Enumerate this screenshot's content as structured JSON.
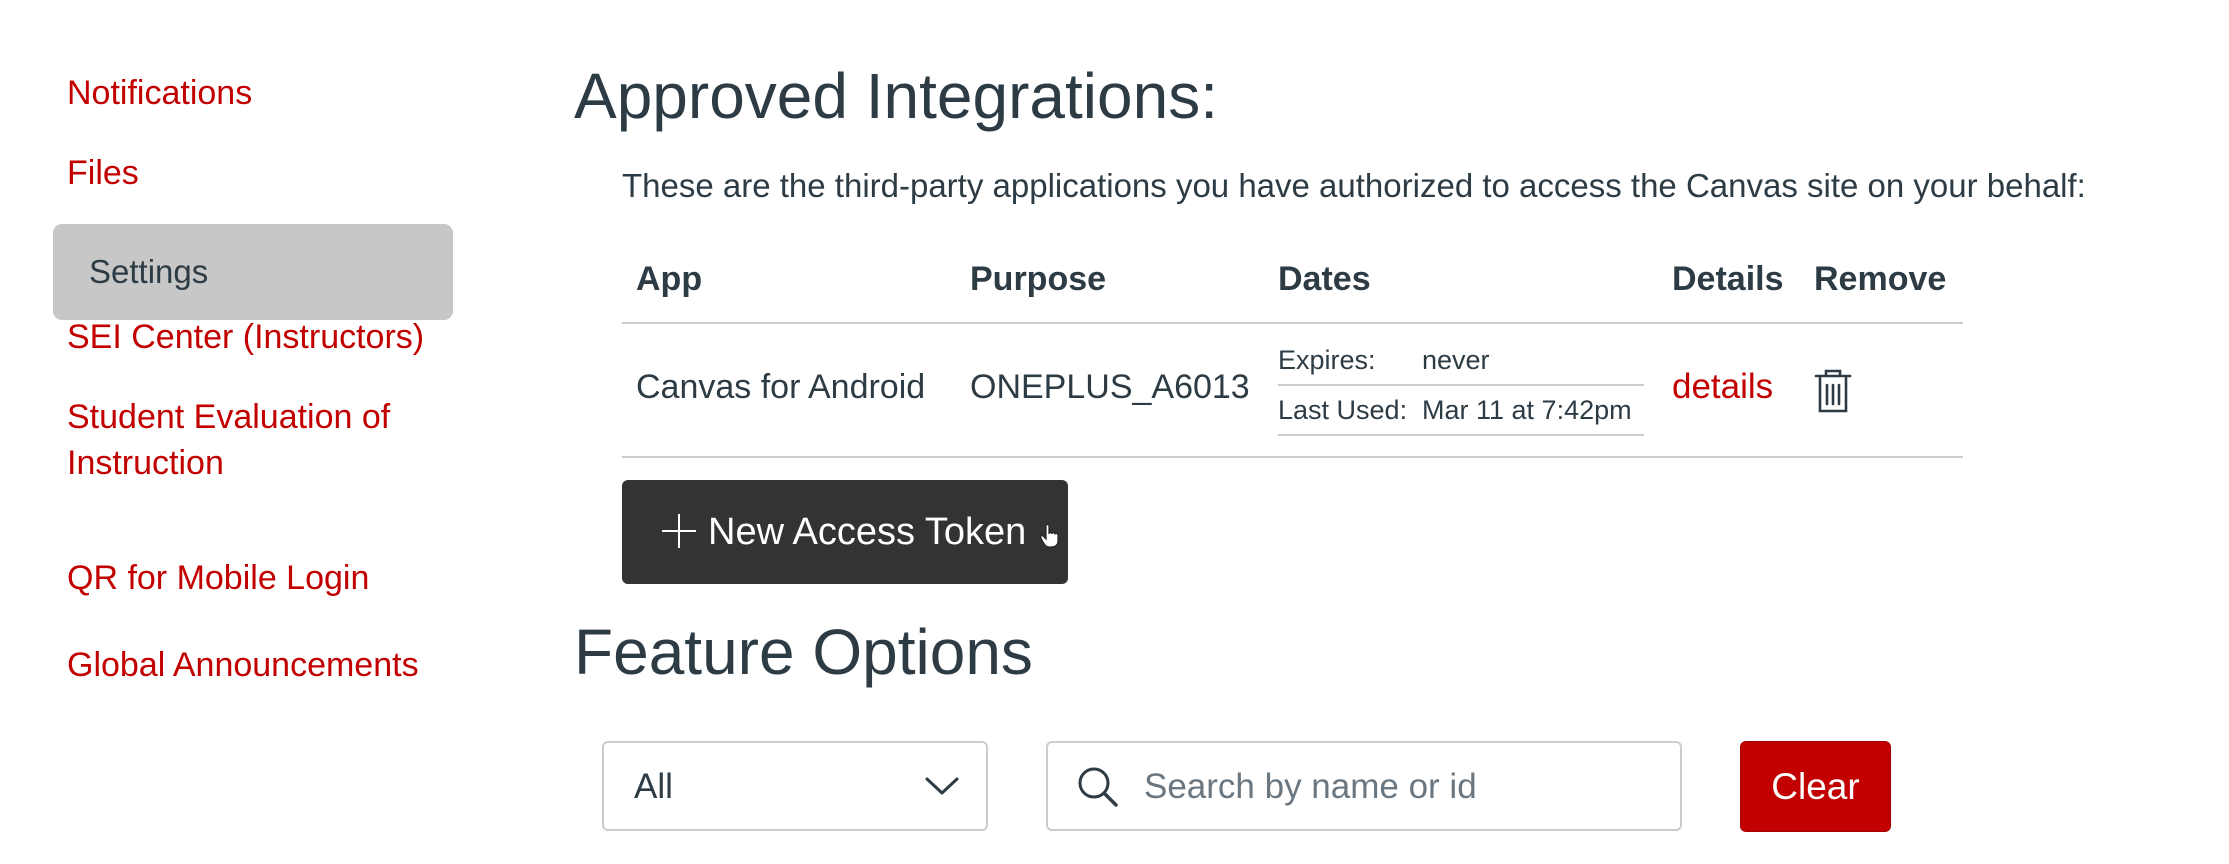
{
  "sidebar": {
    "items": [
      {
        "label": "Notifications"
      },
      {
        "label": "Files"
      },
      {
        "label": "Settings",
        "active": true
      },
      {
        "label": "SEI Center (Instructors)"
      },
      {
        "label": "Student Evaluation of"
      },
      {
        "label": "Instruction"
      },
      {
        "label": "QR for Mobile Login"
      },
      {
        "label": "Global Announcements"
      }
    ]
  },
  "integrations": {
    "heading": "Approved Integrations:",
    "intro": "These are the third-party applications you have authorized to access the Canvas site on your behalf:",
    "columns": {
      "app": "App",
      "purpose": "Purpose",
      "dates": "Dates",
      "details": "Details",
      "remove": "Remove"
    },
    "rows": [
      {
        "app": "Canvas for Android",
        "purpose": "ONEPLUS_A6013",
        "expires_label": "Expires:",
        "expires_value": "never",
        "last_used_label": "Last Used:",
        "last_used_value": "Mar 11 at 7:42pm",
        "details_link": "details",
        "remove_icon": "trash-icon"
      }
    ],
    "new_token_button": "New Access Token"
  },
  "feature_options": {
    "heading": "Feature Options",
    "filter_value": "All",
    "search_placeholder": "Search by name or id",
    "search_value": "",
    "clear_button": "Clear"
  },
  "colors": {
    "link": "#c20000",
    "text": "#2d3b45",
    "active_nav_bg": "#c7c7c7",
    "dark_button": "#333333",
    "danger_button": "#c20000",
    "border": "#c7cdd1"
  }
}
